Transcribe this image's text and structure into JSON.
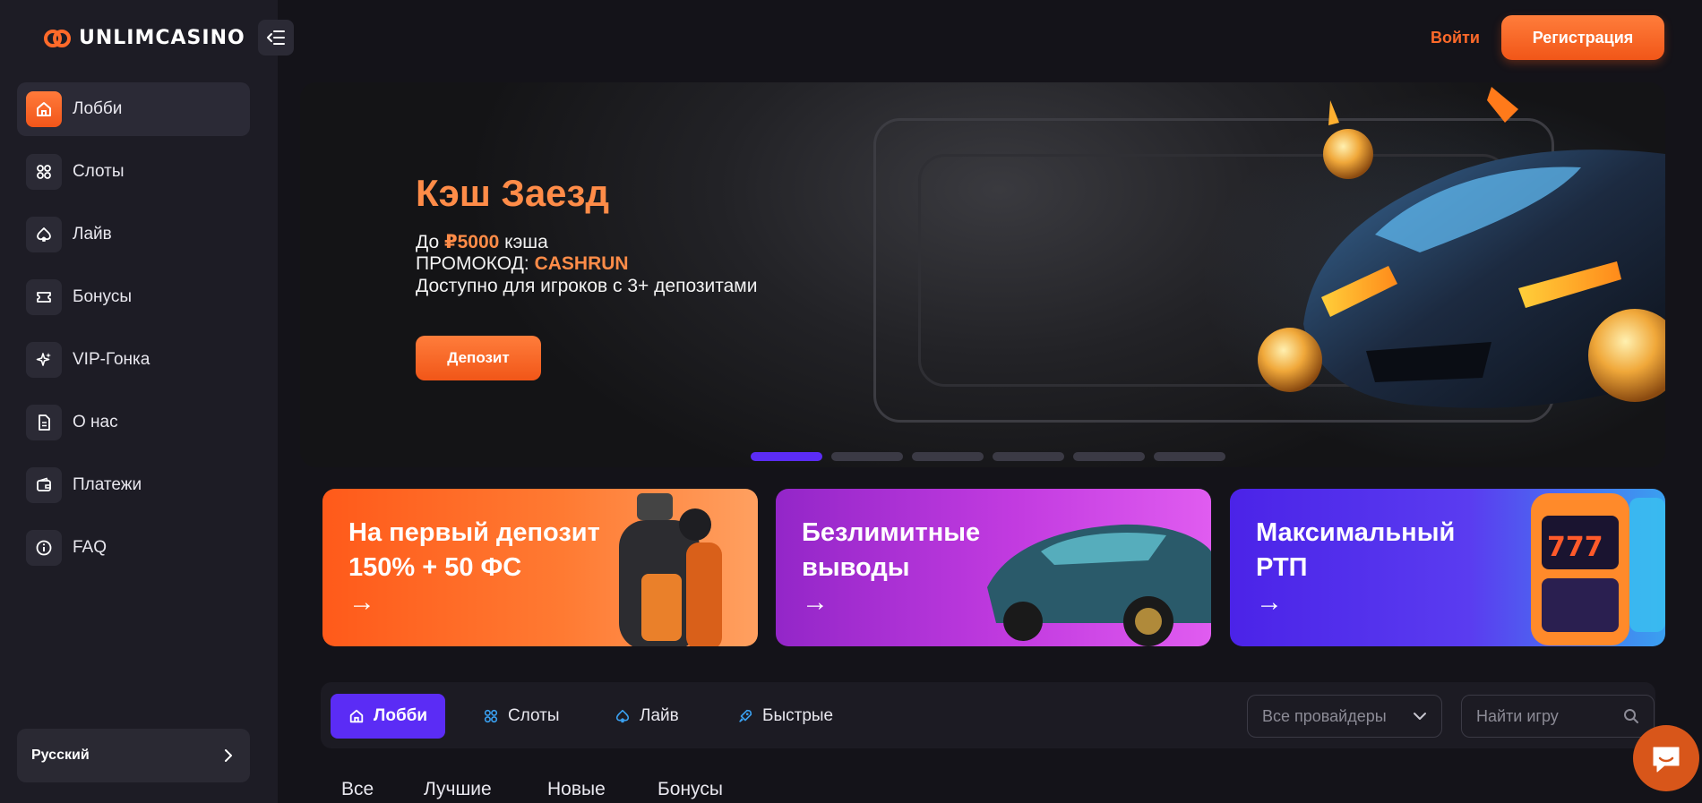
{
  "brand": {
    "name": "UNLIMCASINO",
    "accent": "#f15618",
    "purple": "#5b2cf5"
  },
  "sidebar": {
    "collapse_icon": "sidebar-collapse-icon",
    "items": [
      {
        "label": "Лобби",
        "icon": "home-icon",
        "active": true
      },
      {
        "label": "Слоты",
        "icon": "grid-icon"
      },
      {
        "label": "Лайв",
        "icon": "spade-icon"
      },
      {
        "label": "Бонусы",
        "icon": "ticket-icon"
      },
      {
        "label": "VIP-Гонка",
        "icon": "sparkle-icon"
      },
      {
        "label": "О нас",
        "icon": "document-icon"
      },
      {
        "label": "Платежи",
        "icon": "wallet-icon"
      },
      {
        "label": "FAQ",
        "icon": "info-icon"
      }
    ],
    "language": {
      "label": "Русский"
    }
  },
  "header": {
    "login_label": "Войти",
    "register_label": "Регистрация"
  },
  "hero": {
    "title": "Кэш Заезд",
    "line1_prefix": "До ",
    "line1_amount": "₽5000",
    "line1_suffix": " кэша",
    "line2_prefix": "ПРОМОКОД: ",
    "line2_code": "CASHRUN",
    "line3": "Доступно для игроков с 3+ депозитами",
    "button_label": "Депозит",
    "slides_total": 6,
    "active_slide": 1
  },
  "promos": [
    {
      "title_line1": "На первый депозит",
      "title_line2": "150% + 50 ФС",
      "arrow": "→"
    },
    {
      "title_line1": "Безлимитные",
      "title_line2": "выводы",
      "arrow": "→"
    },
    {
      "title_line1": "Максимальный",
      "title_line2": "РТП",
      "arrow": "→"
    }
  ],
  "game_tabs": [
    {
      "label": "Лобби",
      "icon": "home-icon",
      "active": true
    },
    {
      "label": "Слоты",
      "icon": "grid-icon"
    },
    {
      "label": "Лайв",
      "icon": "spade-icon"
    },
    {
      "label": "Быстрые",
      "icon": "rocket-icon"
    }
  ],
  "filters": {
    "providers_selected": "Все провайдеры",
    "search_placeholder": "Найти игру"
  },
  "sub_tabs": [
    "Все",
    "Лучшие",
    "Новые",
    "Бонусы"
  ]
}
